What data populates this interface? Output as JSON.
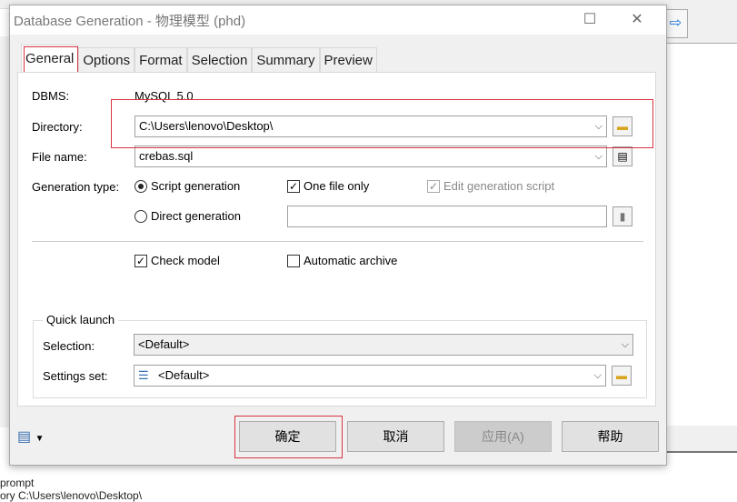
{
  "window": {
    "title": "Database Generation - 物理模型 (phd)",
    "maximize_icon": "maximize-icon",
    "close_icon": "close-icon"
  },
  "tabs": [
    {
      "label": "General",
      "active": true
    },
    {
      "label": "Options"
    },
    {
      "label": "Format"
    },
    {
      "label": "Selection"
    },
    {
      "label": "Summary"
    },
    {
      "label": "Preview"
    }
  ],
  "general": {
    "dbms_label": "DBMS:",
    "dbms_value": "MySQL 5.0",
    "directory_label": "Directory:",
    "directory_value": "C:\\Users\\lenovo\\Desktop\\",
    "filename_label": "File name:",
    "filename_value": "crebas.sql",
    "gentype_label": "Generation type:",
    "script_generation": "Script generation",
    "script_generation_selected": true,
    "direct_generation": "Direct generation",
    "direct_generation_selected": false,
    "one_file_only": "One file only",
    "one_file_only_checked": true,
    "edit_script": "Edit generation script",
    "edit_script_checked": true,
    "direct_value": "",
    "check_model": "Check model",
    "check_model_checked": true,
    "automatic_archive": "Automatic archive",
    "automatic_archive_checked": false
  },
  "quick_launch": {
    "title": "Quick launch",
    "selection_label": "Selection:",
    "selection_value": "<Default>",
    "settings_label": "Settings set:",
    "settings_value": "<Default>"
  },
  "buttons": {
    "ok": "确定",
    "cancel": "取消",
    "apply": "应用(A)",
    "help": "帮助"
  },
  "background": {
    "line1": "prompt",
    "line2": "ory C:\\Users\\lenovo\\Desktop\\"
  },
  "colors": {
    "highlight": "#d9333f"
  }
}
